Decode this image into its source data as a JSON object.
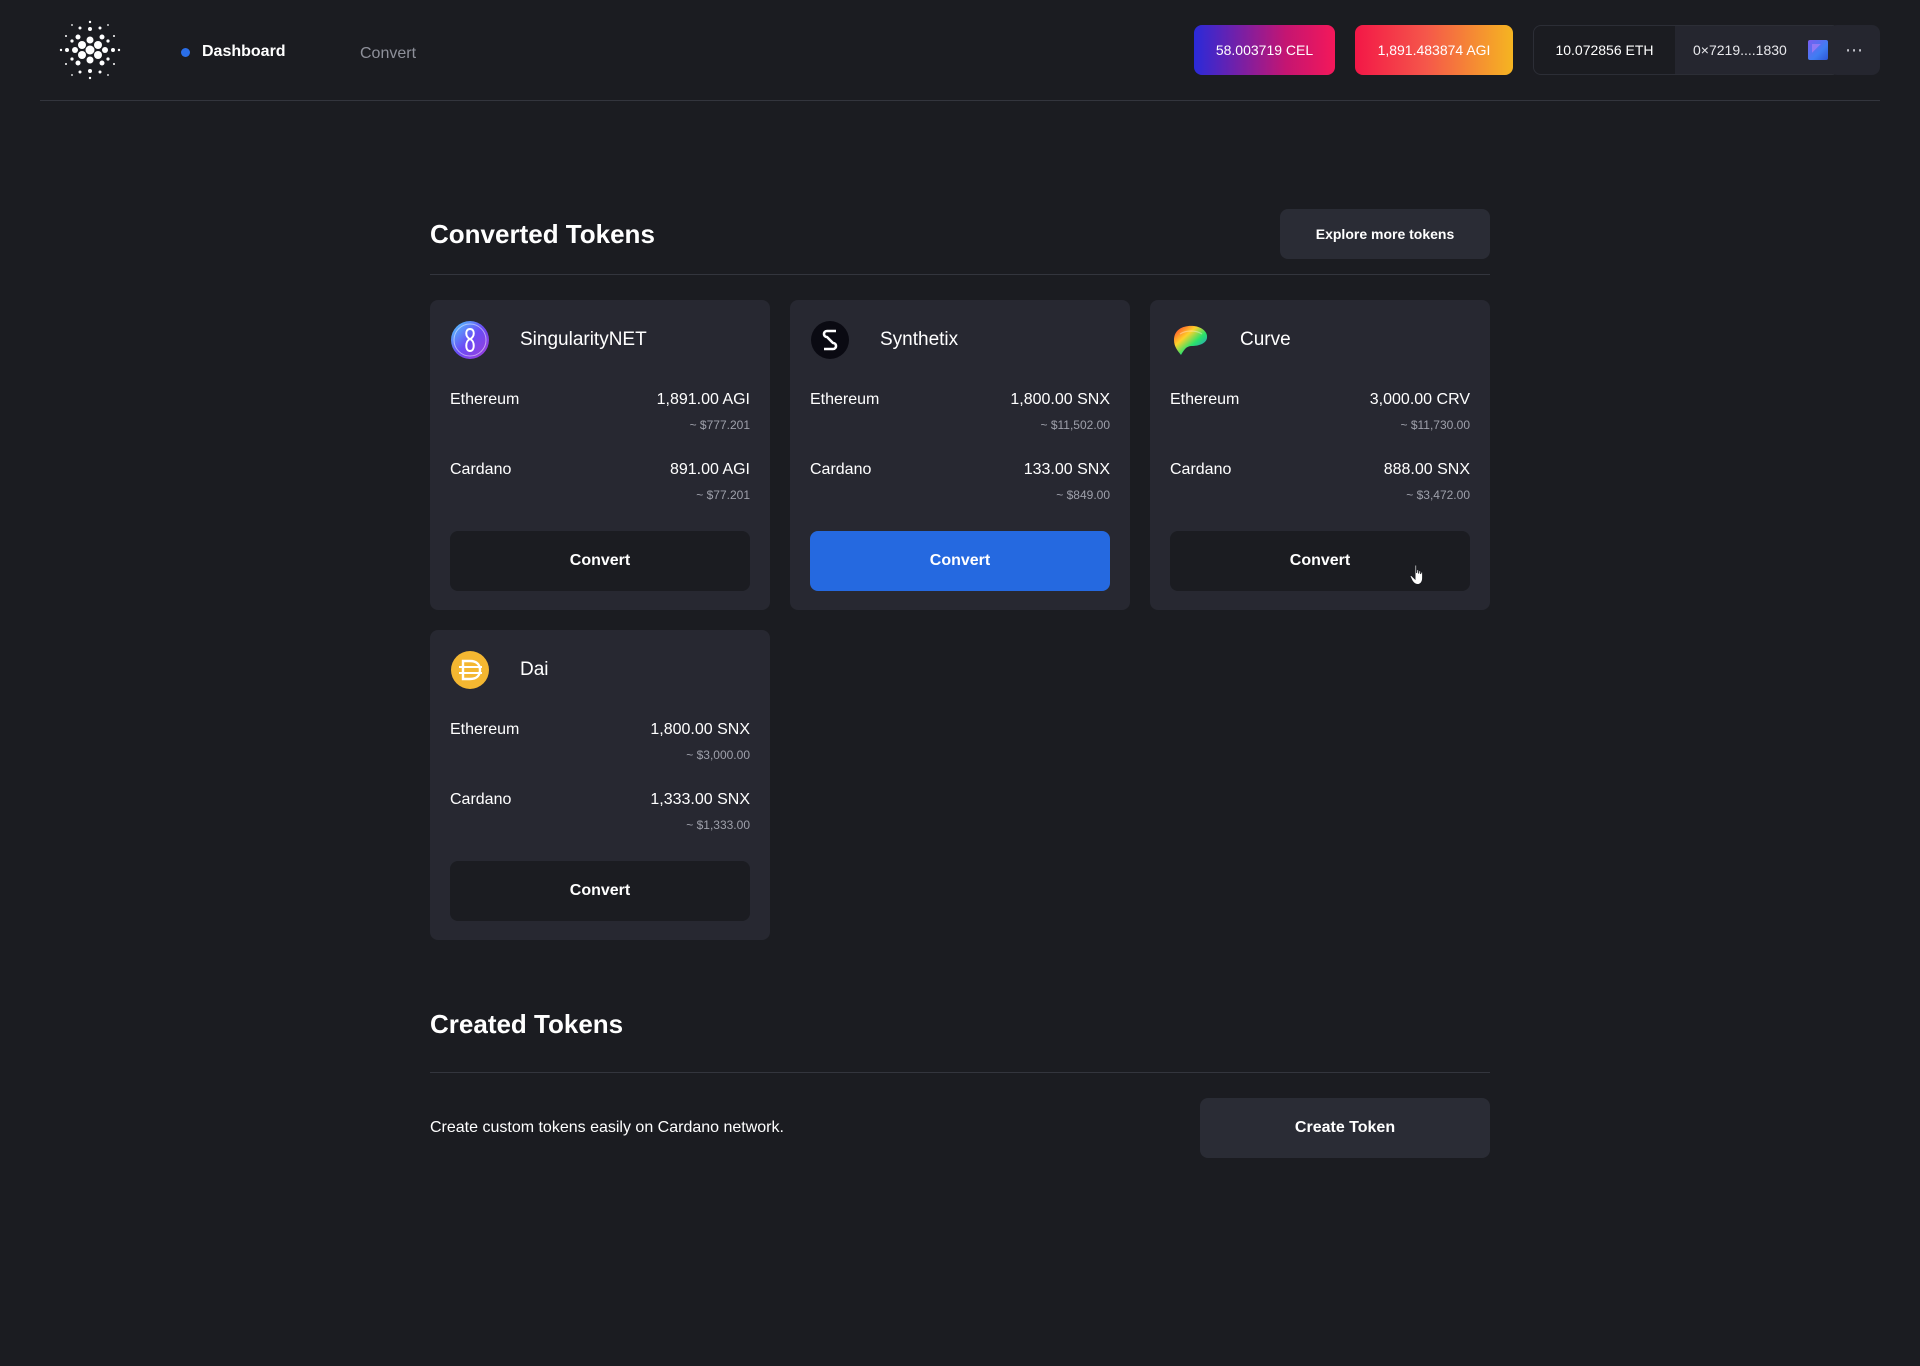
{
  "header": {
    "nav": {
      "dashboard_label": "Dashboard",
      "convert_label": "Convert"
    },
    "balances": {
      "cel": "58.003719 CEL",
      "agi": "1,891.483874 AGI",
      "eth": "10.072856 ETH"
    },
    "wallet_address": "0×7219....1830",
    "more_icon": "⋯"
  },
  "converted": {
    "title": "Converted Tokens",
    "explore_label": "Explore more tokens",
    "tokens": [
      {
        "name": "SingularityNET",
        "icon": "singularitynet-icon",
        "rows": [
          {
            "network": "Ethereum",
            "amount": "1,891.00 AGI",
            "usd": "~ $777.201"
          },
          {
            "network": "Cardano",
            "amount": "891.00 AGI",
            "usd": "~ $77.201"
          }
        ],
        "button": "Convert"
      },
      {
        "name": "Synthetix",
        "icon": "synthetix-icon",
        "rows": [
          {
            "network": "Ethereum",
            "amount": "1,800.00 SNX",
            "usd": "~ $11,502.00"
          },
          {
            "network": "Cardano",
            "amount": "133.00 SNX",
            "usd": "~ $849.00"
          }
        ],
        "button": "Convert"
      },
      {
        "name": "Curve",
        "icon": "curve-icon",
        "rows": [
          {
            "network": "Ethereum",
            "amount": "3,000.00 CRV",
            "usd": "~ $11,730.00"
          },
          {
            "network": "Cardano",
            "amount": "888.00 SNX",
            "usd": "~ $3,472.00"
          }
        ],
        "button": "Convert"
      },
      {
        "name": "Dai",
        "icon": "dai-icon",
        "rows": [
          {
            "network": "Ethereum",
            "amount": "1,800.00 SNX",
            "usd": "~ $3,000.00"
          },
          {
            "network": "Cardano",
            "amount": "1,333.00 SNX",
            "usd": "~ $1,333.00"
          }
        ],
        "button": "Convert"
      }
    ]
  },
  "created": {
    "title": "Created Tokens",
    "description": "Create custom tokens easily on Cardano network.",
    "button": "Create Token"
  },
  "colors": {
    "accent": "#2569e0",
    "background": "#1b1c21",
    "card": "#272831"
  }
}
